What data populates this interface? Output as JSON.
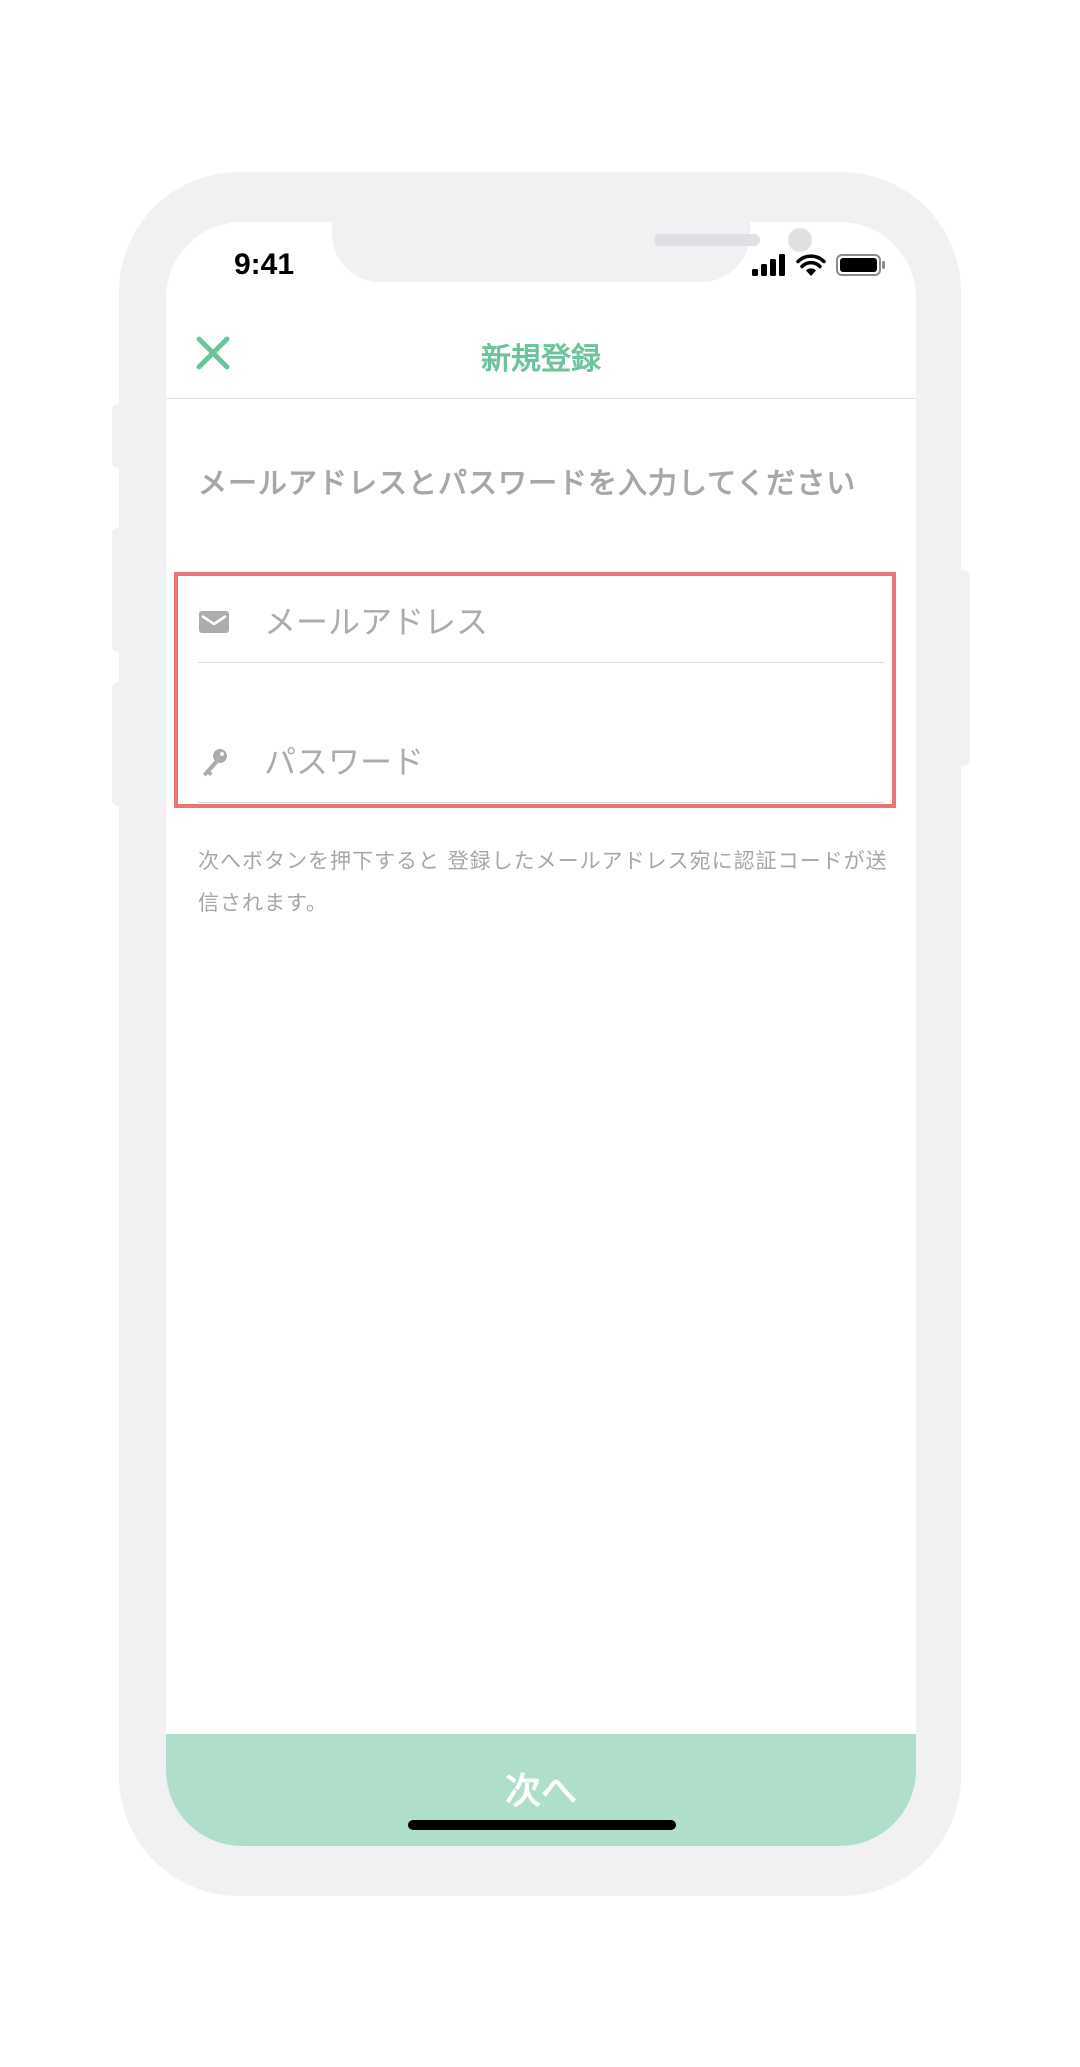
{
  "status_bar": {
    "time": "9:41"
  },
  "nav": {
    "title": "新規登録",
    "close_icon": "close-icon"
  },
  "instruction": "メールアドレスとパスワードを入力してください",
  "form": {
    "email": {
      "icon": "mail-icon",
      "placeholder": "メールアドレス",
      "value": ""
    },
    "password": {
      "icon": "key-icon",
      "placeholder": "パスワード",
      "value": ""
    }
  },
  "note": "次へボタンを押下すると 登録したメールアドレス宛に認証コードが送信されます。",
  "next_button": {
    "label": "次へ"
  },
  "colors": {
    "accent": "#6cc49b",
    "button": "#afdfcb",
    "highlight": "#ea7374",
    "muted_text": "#a7a7a9"
  }
}
